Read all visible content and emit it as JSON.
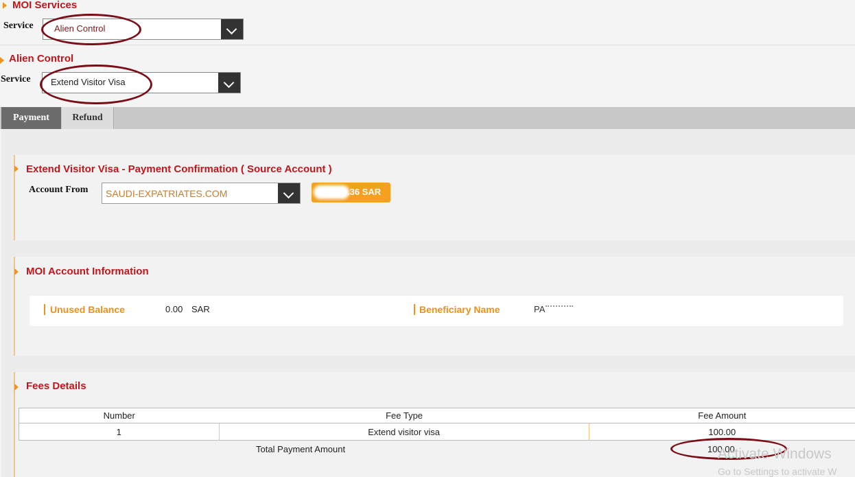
{
  "moi_services": {
    "title": "MOI Services",
    "service_label": "Service",
    "service_value": "Alien Control"
  },
  "alien_control": {
    "title": "Alien Control",
    "service_label": "Service",
    "service_value": "Extend Visitor Visa"
  },
  "tabs": [
    {
      "label": "Payment",
      "active": true
    },
    {
      "label": "Refund",
      "active": false
    }
  ],
  "payment_confirmation": {
    "title": "Extend Visitor Visa - Payment Confirmation ( Source Account )",
    "account_from_label": "Account From",
    "account_value": "SAUDI-EXPATRIATES.COM",
    "balance_badge": ".36 SAR"
  },
  "moi_account": {
    "title": "MOI Account Information",
    "unused_balance_label": "Unused Balance",
    "unused_balance_value": "0.00",
    "unused_balance_currency": "SAR",
    "beneficiary_label": "Beneficiary Name",
    "beneficiary_value": "PA"
  },
  "fees": {
    "title": "Fees Details",
    "columns": [
      "Number",
      "Fee Type",
      "Fee Amount"
    ],
    "rows": [
      {
        "number": "1",
        "fee_type": "Extend visitor visa",
        "fee_amount": "100.00"
      }
    ],
    "total_label": "Total Payment Amount",
    "total_value": "100.00"
  },
  "watermark": {
    "line1": "Activate Windows",
    "line2": "Go to Settings to activate W"
  },
  "colors": {
    "accent_red": "#c0161c",
    "orange": "#f0941d",
    "annotation_oval": "#7a0e16"
  }
}
